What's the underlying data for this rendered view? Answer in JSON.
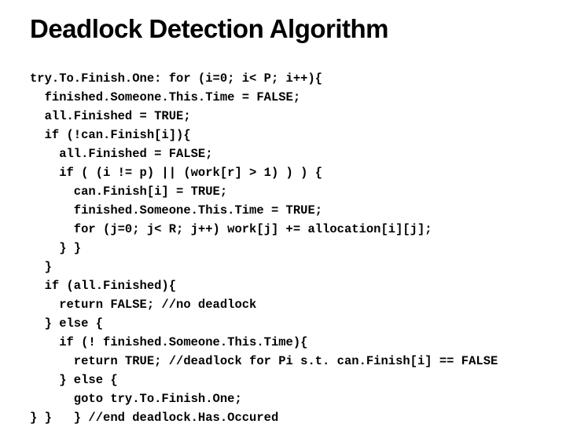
{
  "title": "Deadlock Detection Algorithm",
  "code": {
    "l1": "try.To.Finish.One: for (i=0; i< P; i++){",
    "l2": "  finished.Someone.This.Time = FALSE;",
    "l3": "  all.Finished = TRUE;",
    "l4": "  if (!can.Finish[i]){",
    "l5": "    all.Finished = FALSE;",
    "l6": "    if ( (i != p) || (work[r] > 1) ) ) {",
    "l7": "      can.Finish[i] = TRUE;",
    "l8": "      finished.Someone.This.Time = TRUE;",
    "l9": "      for (j=0; j< R; j++) work[j] += allocation[i][j];",
    "l10": "    } }",
    "l11": "  }",
    "l12": "  if (all.Finished){",
    "l13": "    return FALSE; //no deadlock",
    "l14": "  } else {",
    "l15": "    if (! finished.Someone.This.Time){",
    "l16": "      return TRUE; //deadlock for Pi s.t. can.Finish[i] == FALSE",
    "l17": "    } else {",
    "l18": "      goto try.To.Finish.One;",
    "l19": "} }   } //end deadlock.Has.Occured"
  }
}
